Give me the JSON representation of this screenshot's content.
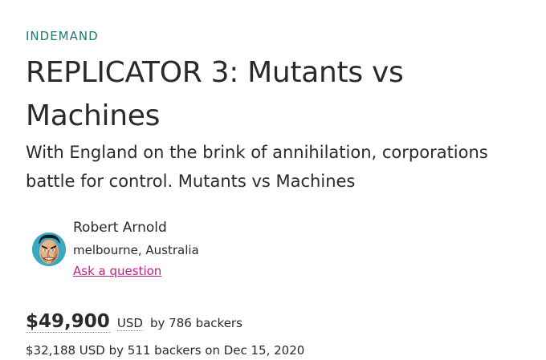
{
  "project": {
    "badge": "INDEMAND",
    "title": "REPLICATOR 3: Mutants vs Machines",
    "blurb": "With England on the brink of annihilation, corporations battle for control. Mutants vs Machines"
  },
  "creator": {
    "name": "Robert Arnold",
    "location": "melbourne, Australia",
    "ask_link": "Ask a question"
  },
  "funding": {
    "amount": "$49,900",
    "currency": "USD",
    "backers_text": "by 786 backers",
    "prior_campaign": "$32,188 USD by 511 backers on Dec 15, 2020"
  },
  "colors": {
    "badge": "#1b7b6c",
    "link": "#c21e8a",
    "text": "#2a2a2a"
  }
}
